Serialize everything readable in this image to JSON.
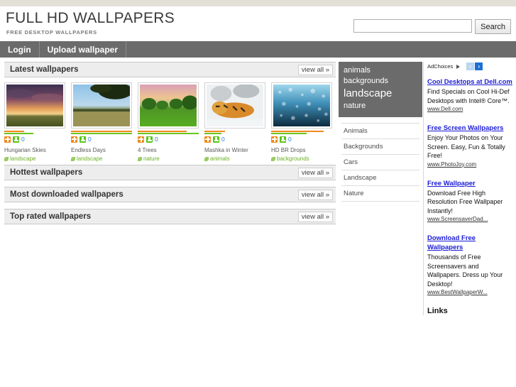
{
  "site": {
    "title": "FULL HD WALLPAPERS",
    "tagline": "FREE DESKTOP WALLPAPERS"
  },
  "search": {
    "value": "",
    "placeholder": "",
    "button_label": "Search"
  },
  "nav": {
    "items": [
      {
        "label": "Login"
      },
      {
        "label": "Upload wallpaper"
      }
    ]
  },
  "sections": {
    "latest": {
      "title": "Latest wallpapers",
      "view_all": "view all »"
    },
    "hottest": {
      "title": "Hottest wallpapers",
      "view_all": "view all »"
    },
    "most_downloaded": {
      "title": "Most downloaded wallpapers",
      "view_all": "view all »"
    },
    "top_rated": {
      "title": "Top rated wallpapers",
      "view_all": "view all »"
    }
  },
  "wallpapers": [
    {
      "name": "Hungarian Skies",
      "tag": "landscape",
      "count": "0",
      "orange_pct": 32,
      "green_pct": 48
    },
    {
      "name": "Endless Days",
      "tag": "landscape",
      "count": "0",
      "orange_pct": 100,
      "green_pct": 100
    },
    {
      "name": "4 Trees",
      "tag": "nature",
      "count": "0",
      "orange_pct": 80,
      "green_pct": 100
    },
    {
      "name": "Mashka in Winter",
      "tag": "animals",
      "count": "0",
      "orange_pct": 34,
      "green_pct": 28
    },
    {
      "name": "HD BR Drops",
      "tag": "backgrounds",
      "count": "0",
      "orange_pct": 86,
      "green_pct": 58
    }
  ],
  "tag_cloud": [
    {
      "label": "animals",
      "size": "s1"
    },
    {
      "label": "backgrounds",
      "size": "s2"
    },
    {
      "label": "landscape",
      "size": "s3"
    },
    {
      "label": "nature",
      "size": "s4"
    }
  ],
  "categories": [
    {
      "label": "Animals"
    },
    {
      "label": "Backgrounds"
    },
    {
      "label": "Cars"
    },
    {
      "label": "Landscape"
    },
    {
      "label": "Nature"
    }
  ],
  "ads": {
    "adchoices_label": "AdChoices",
    "prev_arrow": "‹",
    "next_arrow": "›",
    "items": [
      {
        "title": "Cool Desktops at Dell.com",
        "desc": "Find Specials on Cool Hi-Def Desktops with Intel® Core™.",
        "url": "www.Dell.com"
      },
      {
        "title": "Free Screen Wallpapers",
        "desc": "Enjoy Your Photos on Your Screen. Easy, Fun & Totally Free!",
        "url": "www.PhotoJoy.com"
      },
      {
        "title": "Free Wallpaper",
        "desc": "Download Free High Resolution Free Wallpaper Instantly!",
        "url": "www.ScreensaverDad..."
      },
      {
        "title": "Download Free Wallpapers",
        "desc": "Thousands of Free Screensavers and Wallpapers. Dress up Your Desktop!",
        "url": "www.BestWallpaperW..."
      }
    ],
    "links_heading": "Links"
  },
  "colors": {
    "nav_bg": "#6b6b6b",
    "bar_orange": "#f08a1e",
    "bar_green": "#6ac51a",
    "ad_link": "#1a1ad6",
    "tag_green": "#6ab021"
  }
}
